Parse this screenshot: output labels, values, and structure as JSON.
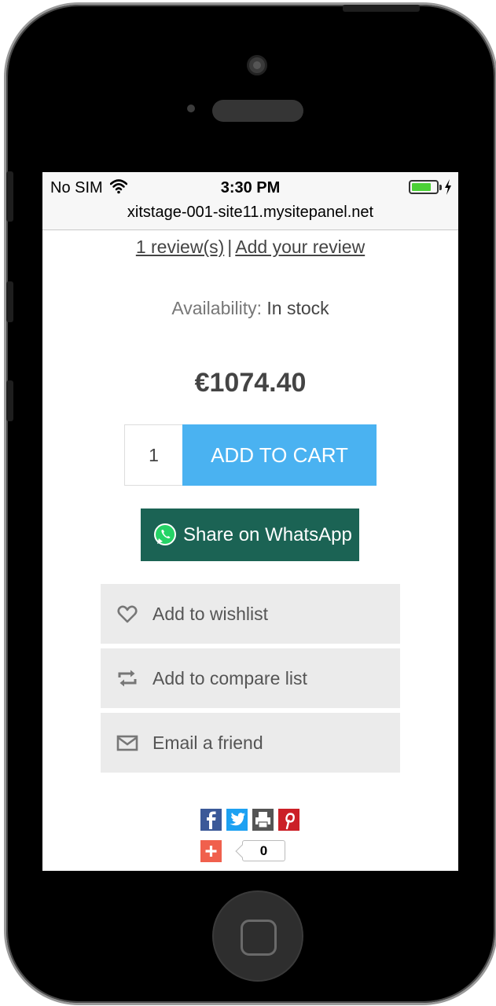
{
  "status_bar": {
    "carrier": "No SIM",
    "time": "3:30 PM",
    "battery_level": 0.8,
    "battery_color": "#4cd137"
  },
  "browser": {
    "url": "xitstage-001-site11.mysitepanel.net"
  },
  "product": {
    "reviews_link": "1 review(s)",
    "separator": "|",
    "add_review_link": "Add your review",
    "availability_label": "Availability:",
    "availability_value": "In stock",
    "price": "€1074.40",
    "quantity": "1",
    "add_to_cart": "ADD TO CART",
    "whatsapp_share": "Share on WhatsApp"
  },
  "actions": {
    "wishlist": "Add to wishlist",
    "compare": "Add to compare list",
    "email": "Email a friend"
  },
  "social": {
    "icons": [
      "facebook-icon",
      "twitter-icon",
      "print-icon",
      "pinterest-icon",
      "plus-share-icon"
    ],
    "share_count": "0"
  },
  "colors": {
    "accent_blue": "#4ab2f1",
    "whatsapp_green": "#1b6354",
    "action_bg": "#ebebeb"
  }
}
